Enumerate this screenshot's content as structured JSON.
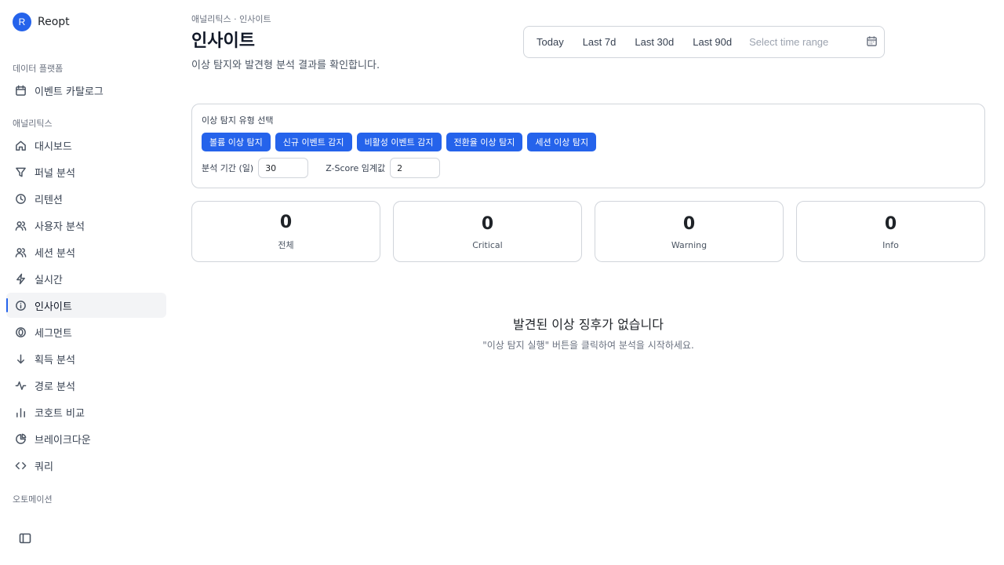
{
  "brand": {
    "avatar_letter": "R",
    "name": "Reopt"
  },
  "sidebar": {
    "sections": {
      "data_platform": "데이터 플랫폼",
      "analytics": "애널리틱스",
      "automation": "오토메이션"
    },
    "items": [
      {
        "label": "이벤트 카탈로그",
        "icon": "calendar-icon"
      },
      {
        "label": "대시보드",
        "icon": "home-icon"
      },
      {
        "label": "퍼널 분석",
        "icon": "filter-icon"
      },
      {
        "label": "리텐션",
        "icon": "clock-icon"
      },
      {
        "label": "사용자 분석",
        "icon": "users-icon"
      },
      {
        "label": "세션 분석",
        "icon": "users-icon"
      },
      {
        "label": "실시간",
        "icon": "bolt-icon"
      },
      {
        "label": "인사이트",
        "icon": "info-icon",
        "active": true
      },
      {
        "label": "세그먼트",
        "icon": "segment-icon"
      },
      {
        "label": "획득 분석",
        "icon": "arrow-down-icon"
      },
      {
        "label": "경로 분석",
        "icon": "activity-icon"
      },
      {
        "label": "코호트 비교",
        "icon": "bar-chart-icon"
      },
      {
        "label": "브레이크다운",
        "icon": "pie-chart-icon"
      },
      {
        "label": "쿼리",
        "icon": "code-icon"
      }
    ]
  },
  "header": {
    "breadcrumb": "애널리틱스 · 인사이트",
    "title": "인사이트",
    "subtitle": "이상 탐지와 발견형 분석 결과를 확인합니다."
  },
  "time_range": {
    "options": [
      "Today",
      "Last 7d",
      "Last 30d",
      "Last 90d"
    ],
    "select_placeholder": "Select time range"
  },
  "config": {
    "type_label": "이상 탐지 유형 선택",
    "types": [
      "볼륨 이상 탐지",
      "신규 이벤트 감지",
      "비활성 이벤트 감지",
      "전환율 이상 탐지",
      "세션 이상 탐지"
    ],
    "period_label": "분석 기간 (일)",
    "period_value": "30",
    "zscore_label": "Z-Score 임계값",
    "zscore_value": "2"
  },
  "stats": [
    {
      "value": "0",
      "label": "전체"
    },
    {
      "value": "0",
      "label": "Critical"
    },
    {
      "value": "0",
      "label": "Warning"
    },
    {
      "value": "0",
      "label": "Info"
    }
  ],
  "empty_state": {
    "title": "발견된 이상 징후가 없습니다",
    "description": "\"이상 탐지 실행\" 버튼을 클릭하여 분석을 시작하세요."
  },
  "colors": {
    "accent": "#2563eb",
    "border": "#d1d5db",
    "muted_text": "#6b7280"
  }
}
